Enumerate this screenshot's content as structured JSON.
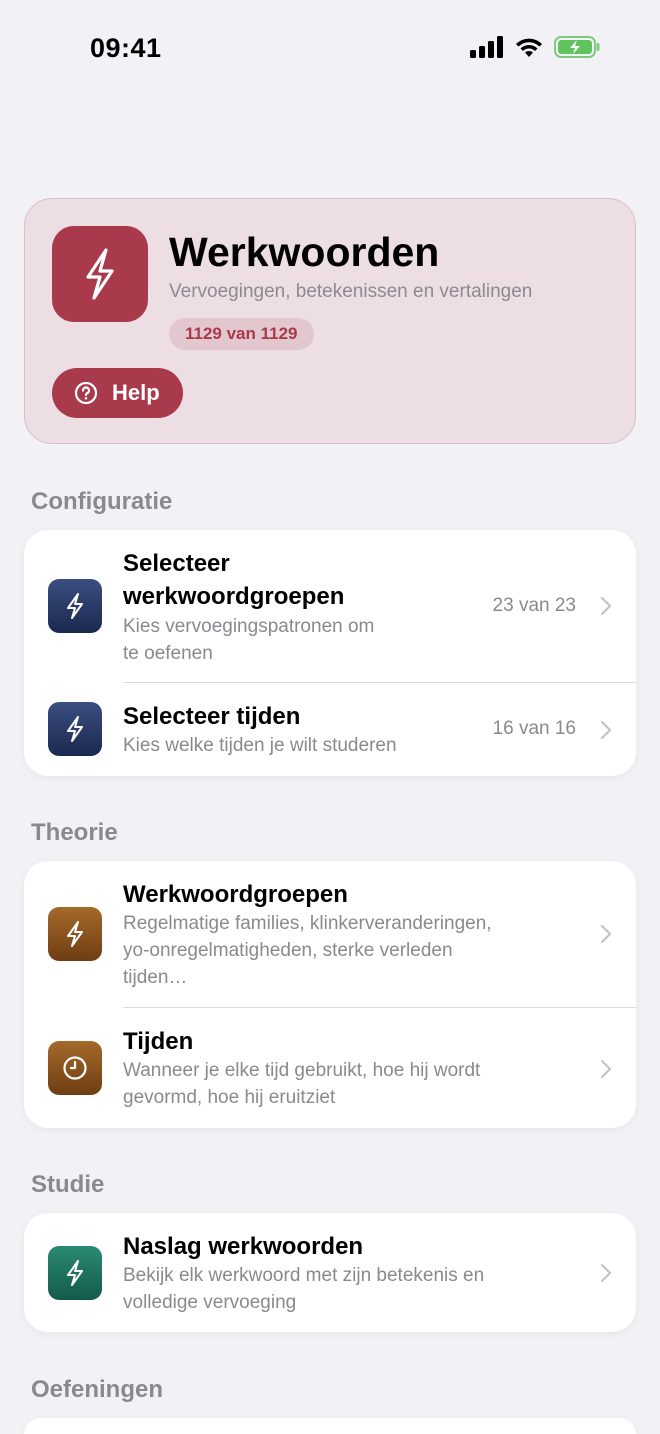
{
  "status_bar": {
    "time": "09:41"
  },
  "header": {
    "title": "Werkwoorden",
    "subtitle": "Vervoegingen, betekenissen en vertalingen",
    "count_badge": "1129 van 1129",
    "help_label": "Help",
    "accent_color": "#a83a4c"
  },
  "sections": {
    "configuratie": {
      "title": "Configuratie",
      "rows": [
        {
          "title_line1": "Selecteer",
          "title_line2": "werkwoordgroepen",
          "sub_line1": "Kies vervoegingspatronen om",
          "sub_line2": "te oefenen",
          "value": "23 van 23",
          "icon": "bolt-icon"
        },
        {
          "title": "Selecteer tijden",
          "sub": "Kies welke tijden je wilt studeren",
          "value": "16 van 16",
          "icon": "bolt-icon"
        }
      ]
    },
    "theorie": {
      "title": "Theorie",
      "rows": [
        {
          "title": "Werkwoordgroepen",
          "sub_line1": "Regelmatige families, klinkerveranderingen,",
          "sub_line2": "yo-onregelmatigheden, sterke verleden",
          "sub_line3": "tijden…",
          "icon": "bolt-icon"
        },
        {
          "title": "Tijden",
          "sub_line1": "Wanneer je elke tijd gebruikt, hoe hij wordt",
          "sub_line2": "gevormd, hoe hij eruitziet",
          "icon": "clock-icon"
        }
      ]
    },
    "studie": {
      "title": "Studie",
      "rows": [
        {
          "title": "Naslag werkwoorden",
          "sub_line1": "Bekijk elk werkwoord met zijn betekenis en",
          "sub_line2": "volledige vervoeging",
          "icon": "bolt-icon"
        }
      ]
    },
    "oefeningen": {
      "title": "Oefeningen"
    }
  }
}
